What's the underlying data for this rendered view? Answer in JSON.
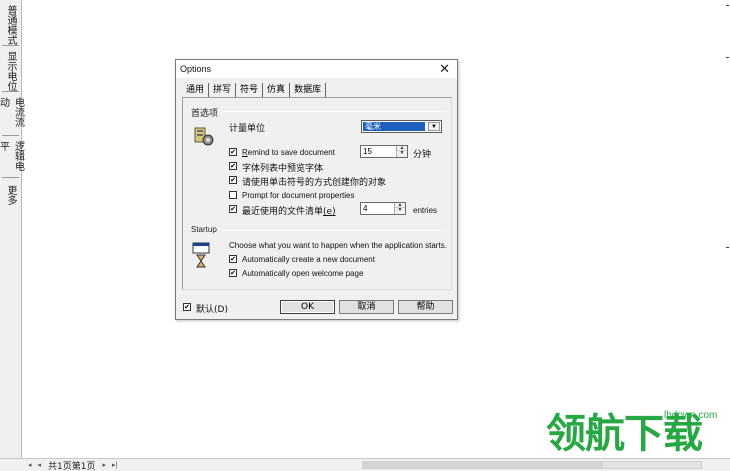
{
  "left_tabs": [
    {
      "label": "普通模式"
    },
    {
      "label": "显示电位"
    },
    {
      "label": "电流流动"
    },
    {
      "label": "逻辑电平"
    },
    {
      "label": "更多"
    }
  ],
  "status_bar": {
    "page_info": "共1页第1页",
    "nav_first": "◂",
    "nav_prev": "◂",
    "nav_next": "▸",
    "nav_last": "▸|"
  },
  "watermark": {
    "text": "领航下载",
    "domain": "lhdown.com"
  },
  "dialog": {
    "title": "Options",
    "close": "✕",
    "tabs": [
      "通用",
      "拼写",
      "符号",
      "仿真",
      "数据库"
    ],
    "preferences_label": "首选项",
    "unit_label": "计量单位",
    "unit_value": "毫米",
    "remind_label": "Remind to save document",
    "remind_minutes": "15",
    "minutes_unit": "分钟",
    "preview_fonts_label": "字体列表中预览字体",
    "single_click_label": "请使用单击符号的方式创建你的对象",
    "prompt_props_label": "Prompt for document properties",
    "recent_files_label": "最近使用的文件清单",
    "recent_files_accel": "(e)",
    "recent_count": "4",
    "entries_unit": "entries",
    "startup_label": "Startup",
    "startup_desc": "Choose what you want to happen when the application starts.",
    "auto_create_label": "Automatically create a new document",
    "auto_welcome_label": "Automatically open welcome page",
    "default_label": "默认(D)",
    "ok_label": "OK",
    "cancel_label": "取消",
    "help_label": "帮助",
    "checks": {
      "remind": true,
      "preview_fonts": true,
      "single_click": true,
      "prompt_props": false,
      "recent_files": true,
      "auto_create": true,
      "auto_welcome": true,
      "default": true
    }
  },
  "colors": {
    "accent": "#1e5fbe",
    "watermark": "#27a844"
  }
}
